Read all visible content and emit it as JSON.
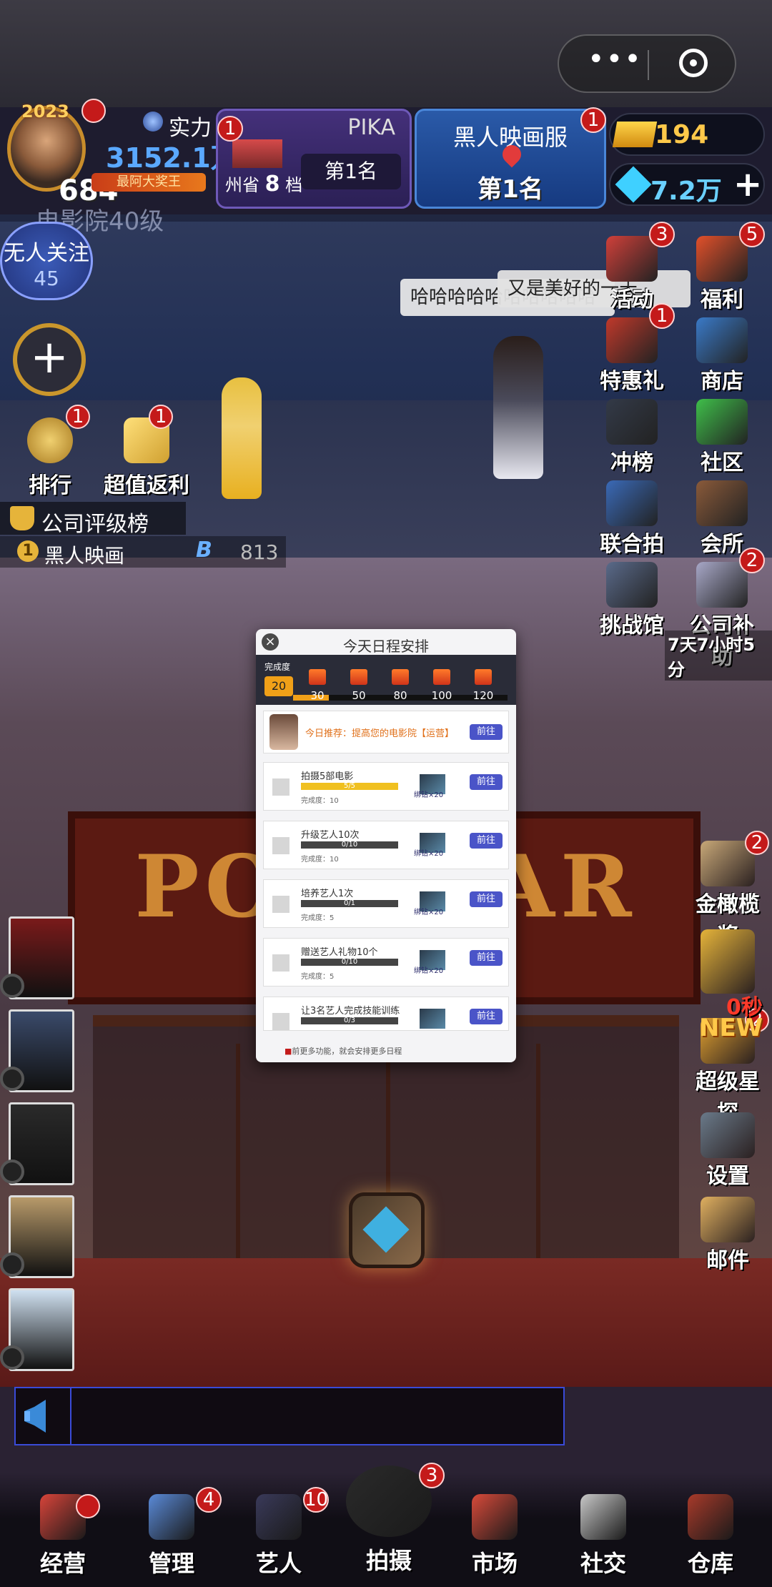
{
  "header": {
    "year_badge": "2023",
    "level": "684",
    "power_label": "实力",
    "power_value": "3152.1万",
    "title_ribbon": "最阿大奖王",
    "studio_level": "电影院40级",
    "avatar_badge": "",
    "rank_panel": {
      "name": "PIKA",
      "province": "州省",
      "grade": "8",
      "grade_suffix": "档",
      "position": "第1名",
      "badge": "1"
    },
    "server_panel": {
      "name": "黑人映画服",
      "position": "第1名",
      "badge": "1"
    },
    "gold": "194",
    "gems": "7.2万",
    "add_symbol": "+"
  },
  "left_menu": {
    "follow_title": "无人关注",
    "follow_count": "45",
    "plus_symbol": "+",
    "items": [
      {
        "label": "排行",
        "badge": "1"
      },
      {
        "label": "超值返利",
        "badge": "1"
      }
    ],
    "rating_title": "公司评级榜",
    "rating_rank": "1",
    "rating_name": "黑人映画",
    "rating_score": "813",
    "rating_icon": "B"
  },
  "bubbles": {
    "left": "哈哈哈哈哈哈哈哈哈哈",
    "right": "又是美好的一天"
  },
  "right_menu": [
    {
      "label": "活动",
      "badge": "3",
      "icon": "activity-icon",
      "color": "#d0403a"
    },
    {
      "label": "福利",
      "badge": "5",
      "icon": "gift-box-icon",
      "color": "#e2502a"
    },
    {
      "label": "特惠礼包",
      "badge": "1",
      "icon": "gift-pack-icon",
      "color": "#c0392b"
    },
    {
      "label": "商店",
      "badge": "",
      "icon": "shop-icon",
      "color": "#3a7ac8"
    },
    {
      "label": "冲榜",
      "badge": "",
      "icon": "clapper-icon",
      "color": "#333a48"
    },
    {
      "label": "社区",
      "badge": "",
      "icon": "chat-icon",
      "color": "#3fbf4a"
    },
    {
      "label": "联合拍摄",
      "badge": "",
      "icon": "joint-shoot-icon",
      "color": "#3a6ab8"
    },
    {
      "label": "会所",
      "badge": "",
      "icon": "club-icon",
      "color": "#8a5a3a"
    },
    {
      "label": "挑战馆",
      "badge": "",
      "icon": "challenge-icon",
      "color": "#5a6a8a"
    },
    {
      "label": "公司补助",
      "badge": "2",
      "icon": "subsidy-icon",
      "color": "#a8a8c8"
    }
  ],
  "subsidy_timer": "7天7小时5分",
  "right_lower": [
    {
      "label": "金橄榄奖",
      "badge": "2",
      "icon": "golden-olive-icon",
      "color": "#c8a878"
    },
    {
      "label": "",
      "badge": "",
      "icon": "trophy-icon",
      "color": "#e6b43a"
    },
    {
      "label": "超级星探",
      "badge": "2",
      "icon": "star-scout-icon",
      "color": "#e0a030"
    },
    {
      "label": "设置",
      "badge": "",
      "icon": "gear-icon",
      "color": "#6a7a8a"
    },
    {
      "label": "邮件",
      "badge": "",
      "icon": "mail-icon",
      "color": "#e0b060"
    }
  ],
  "trophy_timer": "0秒",
  "new_label": "NEW",
  "sign_text": "POPSTAR",
  "schedule": {
    "title": "今天日程安排",
    "close": "×",
    "progress_label": "完成度",
    "progress_current": "20",
    "progress_max": 120,
    "progress_value": 20,
    "milestones": [
      "30",
      "50",
      "80",
      "100",
      "120"
    ],
    "promo_text": "今日推荐：提高您的电影院【运营】",
    "go_label": "前往",
    "tasks": [
      {
        "name": "拍摄5部电影",
        "count": "5/5",
        "progress": 1.0,
        "sub": "完成度：10",
        "reward": "绑钻×20"
      },
      {
        "name": "升级艺人10次",
        "count": "0/10",
        "progress": 0.0,
        "sub": "完成度：10",
        "reward": "绑钻×20"
      },
      {
        "name": "培养艺人1次",
        "count": "0/1",
        "progress": 0.0,
        "sub": "完成度：5",
        "reward": "绑钻×20"
      },
      {
        "name": "赠送艺人礼物10个",
        "count": "0/10",
        "progress": 0.0,
        "sub": "完成度：5",
        "reward": "绑钻×20"
      },
      {
        "name": "让3名艺人完成技能训练",
        "count": "0/3",
        "progress": 0.0,
        "sub": "",
        "reward": ""
      }
    ],
    "footer_mark": "■",
    "footer": "前更多功能，就会安排更多日程"
  },
  "posters": [
    {
      "color": "#7a1a1a",
      "icon": "poster-umbrella"
    },
    {
      "color": "#3a4a6a",
      "icon": "poster-castle"
    },
    {
      "color": "#2a2a2a",
      "icon": "poster-dark"
    },
    {
      "color": "#b89a6a",
      "icon": "poster-desert"
    },
    {
      "color": "#cfe0f0",
      "icon": "poster-light"
    }
  ],
  "nav": [
    {
      "label": "经营",
      "badge": "",
      "icon": "popcorn-icon",
      "color": "#d8443a"
    },
    {
      "label": "管理",
      "badge": "4",
      "icon": "management-icon",
      "color": "#5a8ad8"
    },
    {
      "label": "艺人",
      "badge": "10",
      "icon": "artist-icon",
      "color": "#3a3a5a"
    },
    {
      "label": "拍摄",
      "badge": "3",
      "icon": "film-camera-icon",
      "color": "#2a2a2a"
    },
    {
      "label": "市场",
      "badge": "",
      "icon": "market-icon",
      "color": "#d84a3a"
    },
    {
      "label": "社交",
      "badge": "",
      "icon": "coffee-icon",
      "color": "#c8c8c8"
    },
    {
      "label": "仓库",
      "badge": "",
      "icon": "warehouse-icon",
      "color": "#a83a2a"
    }
  ],
  "nav_red_dot": "",
  "capsule": {
    "more": "•••"
  }
}
